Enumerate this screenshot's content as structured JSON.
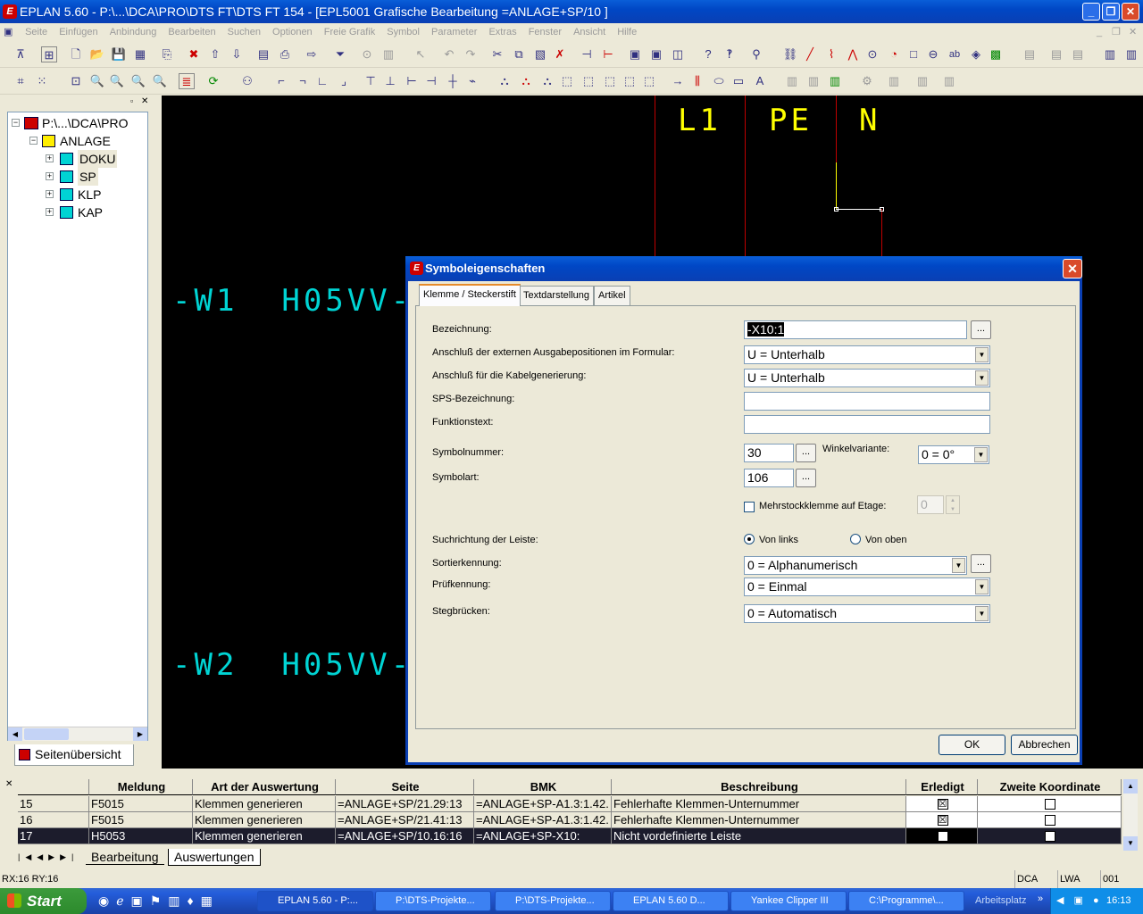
{
  "window": {
    "title": "EPLAN 5.60 - P:\\...\\DCA\\PRO\\DTS FT\\DTS FT 154 - [EPL5001 Grafische Bearbeitung =ANLAGE+SP/10    ]",
    "minimize": "_",
    "maximize": "❐",
    "close": "✕"
  },
  "menu": {
    "items": [
      "Seite",
      "Einfügen",
      "Anbindung",
      "Bearbeiten",
      "Suchen",
      "Optionen",
      "Freie Grafik",
      "Symbol",
      "Parameter",
      "Extras",
      "Fenster",
      "Ansicht",
      "Hilfe"
    ],
    "restore_min": "_",
    "restore_max": "❐",
    "restore_close": "✕"
  },
  "tree": {
    "root": "P:\\...\\DCA\\PRO",
    "anlage": "ANLAGE",
    "children": [
      "DOKU",
      "SP",
      "KLP",
      "KAP"
    ],
    "tab_label": "Seitenübersicht"
  },
  "canvas": {
    "labels": [
      "L1",
      "PE",
      "N"
    ],
    "cables": [
      "-W1  H05VV-F",
      "-W2  H05VV-F"
    ],
    "colors": {
      "yellow": "#ffff00",
      "cyan": "#00d4d4",
      "red": "#c00000",
      "white": "#ffffff"
    }
  },
  "dialog": {
    "title": "Symboleigenschaften",
    "tabs": [
      "Klemme / Steckerstift",
      "Textdarstellung",
      "Artikel"
    ],
    "fields": {
      "bezeichnung_label": "Bezeichnung:",
      "bezeichnung_value": "-X10:1",
      "anschluss_formular_label": "Anschluß der externen Ausgabepositionen im Formular:",
      "anschluss_formular_value": "U = Unterhalb",
      "anschluss_kabel_label": "Anschluß für die Kabelgenerierung:",
      "anschluss_kabel_value": "U = Unterhalb",
      "sps_label": "SPS-Bezeichnung:",
      "sps_value": "",
      "funktionstext_label": "Funktionstext:",
      "funktionstext_value": "",
      "symbolnummer_label": "Symbolnummer:",
      "symbolnummer_value": "30",
      "winkelvariante_label": "Winkelvariante:",
      "winkelvariante_value": "0 = 0°",
      "symbolart_label": "Symbolart:",
      "symbolart_value": "106",
      "mehrstock_label": "Mehrstockklemme auf Etage:",
      "mehrstock_value": "0",
      "suchrichtung_label": "Suchrichtung der Leiste:",
      "von_links": "Von links",
      "von_oben": "Von oben",
      "sortier_label": "Sortierkennung:",
      "sortier_value": "0 = Alphanumerisch",
      "pruef_label": "Prüfkennung:",
      "pruef_value": "0 = Einmal",
      "steg_label": "Stegbrücken:",
      "steg_value": "0 = Automatisch",
      "dots": "..."
    },
    "ok": "OK",
    "cancel": "Abbrechen"
  },
  "results": {
    "columns": [
      "Meldung",
      "Art der Auswertung",
      "Seite",
      "BMK",
      "Beschreibung",
      "Erledigt",
      "Zweite Koordinate"
    ],
    "rows": [
      {
        "nr": "15",
        "meldung": "F5015",
        "art": "Klemmen generieren",
        "seite": "=ANLAGE+SP/21.29:13",
        "bmk": "=ANLAGE+SP-A1.3:1.42.",
        "beschreibung": "Fehlerhafte Klemmen-Unternummer",
        "erledigt": true,
        "zweite": false
      },
      {
        "nr": "16",
        "meldung": "F5015",
        "art": "Klemmen generieren",
        "seite": "=ANLAGE+SP/21.41:13",
        "bmk": "=ANLAGE+SP-A1.3:1.42.",
        "beschreibung": "Fehlerhafte Klemmen-Unternummer",
        "erledigt": true,
        "zweite": false
      },
      {
        "nr": "17",
        "meldung": "H5053",
        "art": "Klemmen generieren",
        "seite": "=ANLAGE+SP/10.16:16",
        "bmk": "=ANLAGE+SP-X10:",
        "beschreibung": "Nicht vordefinierte Leiste",
        "erledigt": false,
        "zweite": false
      }
    ],
    "sheet_tabs": [
      "Bearbeitung",
      "Auswertungen"
    ]
  },
  "status": {
    "coords": "RX:16 RY:16",
    "dca": "DCA",
    "lwa": "LWA",
    "num": "001"
  },
  "taskbar": {
    "start": "Start",
    "tasks": [
      "EPLAN 5.60 - P:...",
      "P:\\DTS-Projekte...",
      "P:\\DTS-Projekte...",
      "EPLAN 5.60   D...",
      "Yankee Clipper III",
      "C:\\Programme\\..."
    ],
    "arbeitsplatz": "Arbeitsplatz",
    "time": "16:13"
  }
}
